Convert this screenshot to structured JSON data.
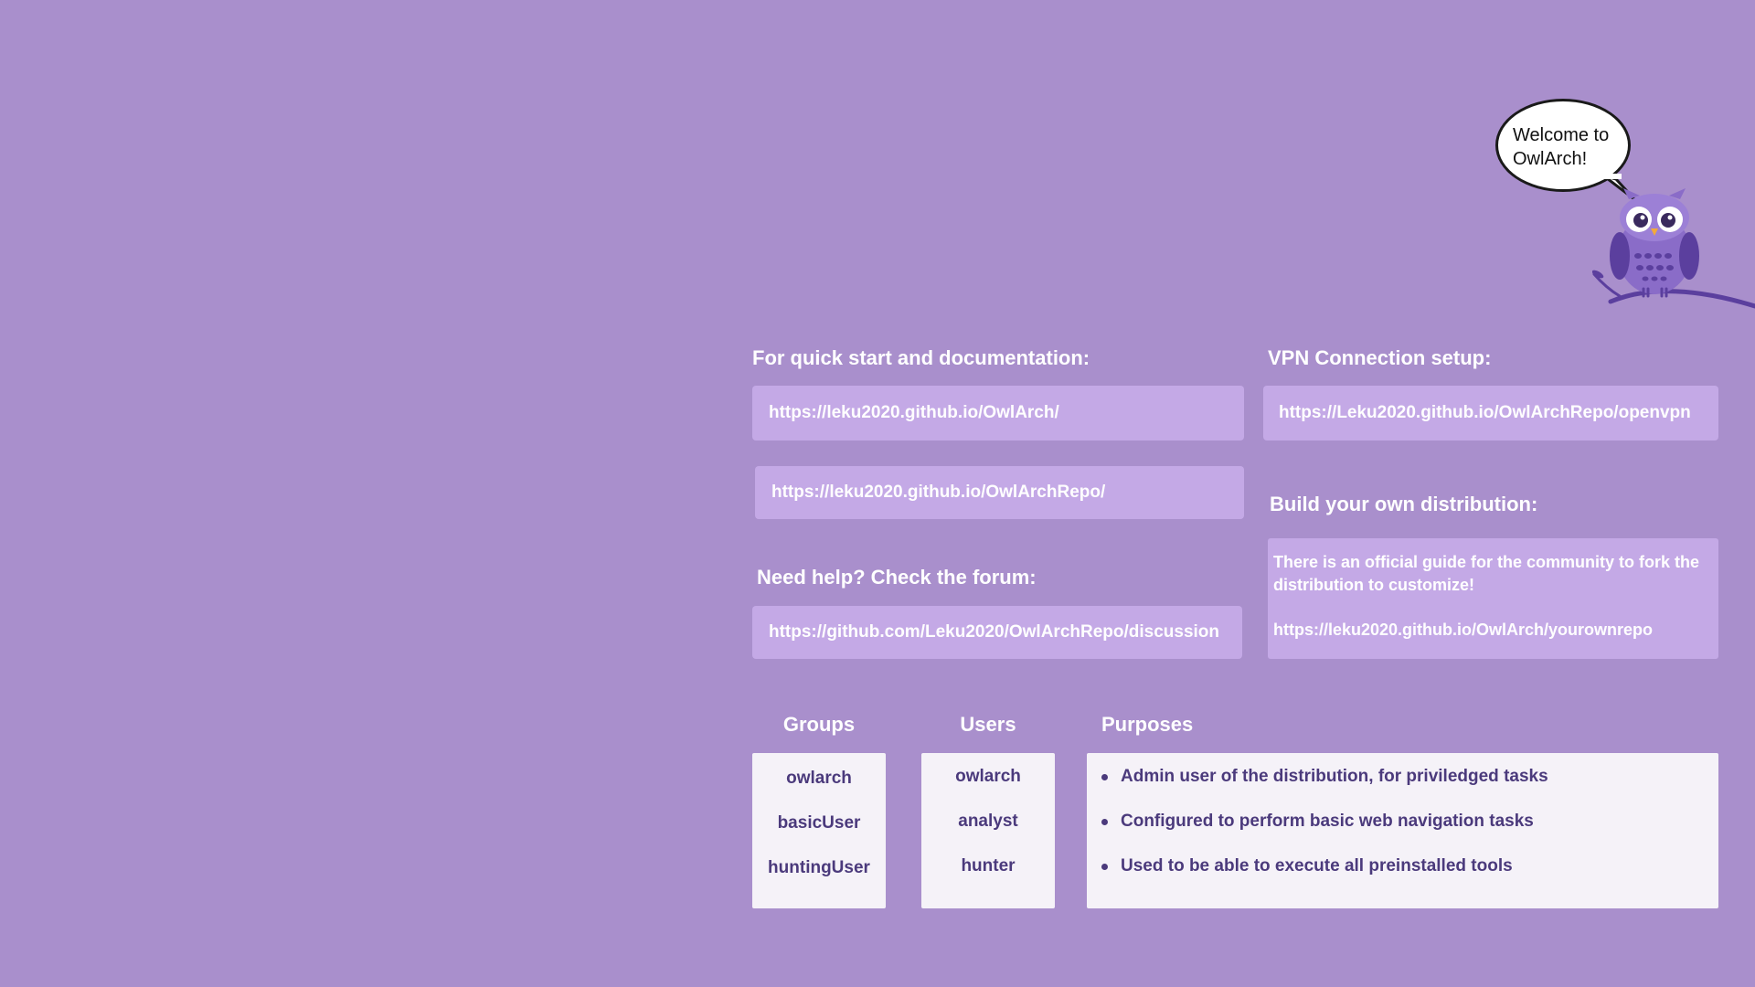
{
  "bubble": {
    "line1": "Welcome to",
    "line2": "OwlArch!"
  },
  "docs": {
    "title": "For quick start and documentation:",
    "link1": "https://leku2020.github.io/OwlArch/",
    "link2": "https://leku2020.github.io/OwlArchRepo/"
  },
  "vpn": {
    "title": "VPN Connection setup:",
    "link": "https://Leku2020.github.io/OwlArchRepo/openvpn"
  },
  "forum": {
    "title": "Need help? Check the forum:",
    "link": "https://github.com/Leku2020/OwlArchRepo/discussion"
  },
  "build": {
    "title": "Build your own distribution:",
    "text": "There is an official guide for the community to fork the distribution to customize!",
    "link": "https://leku2020.github.io/OwlArch/yourownrepo"
  },
  "table": {
    "groups_title": "Groups",
    "users_title": "Users",
    "purposes_title": "Purposes",
    "groups": [
      "owlarch",
      "basicUser",
      "huntingUser"
    ],
    "users": [
      "owlarch",
      "analyst",
      "hunter"
    ],
    "purposes": [
      "Admin user of the distribution, for priviledged tasks",
      "Configured to perform basic web navigation tasks",
      "Used to be able to execute all preinstalled tools"
    ]
  },
  "colors": {
    "background": "#a98fcc",
    "link_box": "#c4a9e6",
    "table_bg": "#f5f2f8",
    "table_text": "#4b3a7c",
    "owl_body": "#8a6cc8",
    "owl_dark": "#5b3f9e"
  },
  "icons": [
    "speech-bubble-icon",
    "owl-mascot-icon",
    "branch-icon"
  ]
}
